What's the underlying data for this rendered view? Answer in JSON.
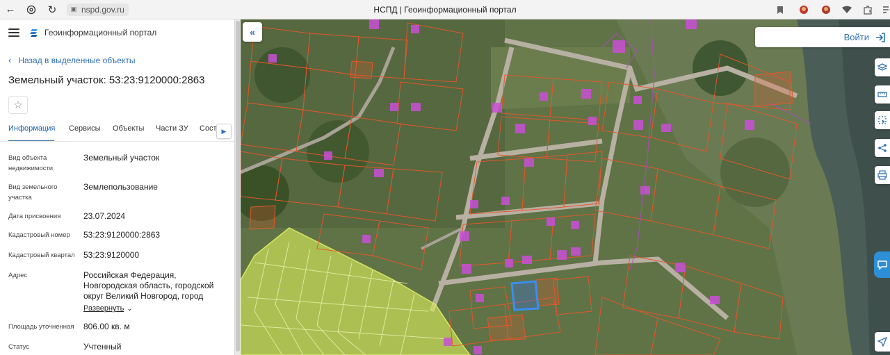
{
  "browser": {
    "url": "nspd.gov.ru",
    "tab_title": "НСПД | Геоинформационный портал"
  },
  "app": {
    "title": "Геоинформационный портал"
  },
  "panel": {
    "back_label": "Назад в выделенные объекты",
    "object_title": "Земельный участок: 53:23:9120000:2863",
    "tabs": [
      "Информация",
      "Сервисы",
      "Объекты",
      "Части ЗУ",
      "Соста"
    ],
    "active_tab": "Информация",
    "properties": [
      {
        "label": "Вид объекта недвижимости",
        "value": "Земельный участок"
      },
      {
        "label": "Вид земельного участка",
        "value": "Землепользование"
      },
      {
        "label": "Дата присвоения",
        "value": "23.07.2024"
      },
      {
        "label": "Кадастровый номер",
        "value": "53:23:9120000:2863"
      },
      {
        "label": "Кадастровый квартал",
        "value": "53:23:9120000"
      },
      {
        "label": "Адрес",
        "value": "Российская Федерация, Новгородская область, городской округ Великий Новгород, город"
      },
      {
        "label": "Площадь уточненная",
        "value": "806.00 кв. м"
      },
      {
        "label": "Статус",
        "value": "Учтенный"
      }
    ],
    "expand_label": "Развернуть"
  },
  "map": {
    "login_label": "Войти",
    "tools": [
      "layers-icon",
      "ruler-icon",
      "select-area-icon",
      "share-icon",
      "print-icon"
    ],
    "colors": {
      "parcel_outline": "#e8562a",
      "selected_parcel": "#3a6fe0",
      "zone_fill": "#d6e85a",
      "building": "#c94fd6"
    }
  }
}
